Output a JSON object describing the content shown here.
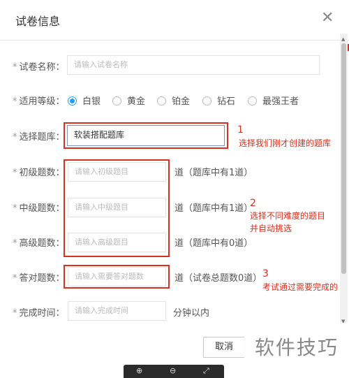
{
  "dialog": {
    "title": "试卷信息",
    "close_glyph": "✕"
  },
  "form": {
    "name": {
      "label": "试卷名称：",
      "placeholder": "请输入试卷名称"
    },
    "level": {
      "label": "适用等级：",
      "options": [
        "白银",
        "黄金",
        "铂金",
        "钻石",
        "最强王者"
      ],
      "selected": "白银"
    },
    "bank": {
      "label": "选择题库：",
      "value": "软装搭配题库"
    },
    "junior": {
      "label": "初级题数：",
      "placeholder": "请输入初级题目",
      "suffix": "道（题库中有1道）"
    },
    "middle": {
      "label": "中级题数：",
      "placeholder": "请输入中级题目",
      "suffix": "道（题库中有1道）"
    },
    "senior": {
      "label": "高级题数：",
      "placeholder": "请输入高级题目",
      "suffix": "道（题库中有0道）"
    },
    "correct": {
      "label": "答对题数：",
      "placeholder": "请输入需要答对题数",
      "suffix": "道（试卷总题数0道）"
    },
    "time": {
      "label": "完成时间：",
      "placeholder": "请输入完成时间",
      "suffix": "分钟以内"
    }
  },
  "annotations": {
    "n1": "1",
    "note1": "选择我们刚才创建的题库",
    "n2": "2",
    "note2a": "选择不同难度的题目",
    "note2b": "并自动挑选",
    "n3": "3",
    "note3": "考试通过需要完成的"
  },
  "footer": {
    "cancel_label": "取消"
  },
  "watermark": "软件技巧",
  "colors": {
    "accent": "#1e9fff",
    "annotation_red": "#d9301f"
  },
  "icons": [
    "close-icon",
    "zoom-in-icon",
    "zoom-out-icon",
    "fullscreen-icon"
  ]
}
